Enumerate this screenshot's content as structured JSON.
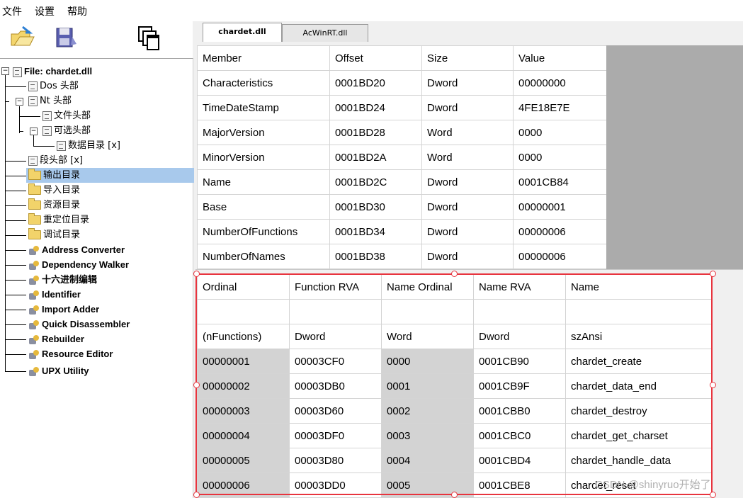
{
  "menu": {
    "file": "文件",
    "settings": "设置",
    "help": "帮助"
  },
  "toolbar": {
    "open_icon": "open-folder-icon",
    "save_icon": "save-disk-icon",
    "windows_icon": "cascade-windows-icon"
  },
  "tree": {
    "root": "File: chardet.dll",
    "dos": "Dos 头部",
    "nt": "Nt 头部",
    "file_header": "文件头部",
    "optional_header": "可选头部",
    "data_dir": "数据目录 [x]",
    "section": "段头部 [x]",
    "export": "输出目录",
    "import": "导入目录",
    "resource": "资源目录",
    "reloc": "重定位目录",
    "debug": "调试目录",
    "tools": [
      "Address Converter",
      "Dependency Walker",
      "十六进制编辑",
      "Identifier",
      "Import Adder",
      "Quick Disassembler",
      "Rebuilder",
      "Resource Editor",
      "UPX Utility"
    ]
  },
  "tabs": [
    "chardet.dll",
    "AcWinRT.dll"
  ],
  "top_table": {
    "headers": [
      "Member",
      "Offset",
      "Size",
      "Value"
    ],
    "rows": [
      [
        "Characteristics",
        "0001BD20",
        "Dword",
        "00000000"
      ],
      [
        "TimeDateStamp",
        "0001BD24",
        "Dword",
        "4FE18E7E"
      ],
      [
        "MajorVersion",
        "0001BD28",
        "Word",
        "0000"
      ],
      [
        "MinorVersion",
        "0001BD2A",
        "Word",
        "0000"
      ],
      [
        "Name",
        "0001BD2C",
        "Dword",
        "0001CB84"
      ],
      [
        "Base",
        "0001BD30",
        "Dword",
        "00000001"
      ],
      [
        "NumberOfFunctions",
        "0001BD34",
        "Dword",
        "00000006"
      ],
      [
        "NumberOfNames",
        "0001BD38",
        "Dword",
        "00000006"
      ]
    ]
  },
  "bottom_table": {
    "headers": [
      "Ordinal",
      "Function RVA",
      "Name Ordinal",
      "Name RVA",
      "Name"
    ],
    "types": [
      "(nFunctions)",
      "Dword",
      "Word",
      "Dword",
      "szAnsi"
    ],
    "rows": [
      [
        "00000001",
        "00003CF0",
        "0000",
        "0001CB90",
        "chardet_create"
      ],
      [
        "00000002",
        "00003DB0",
        "0001",
        "0001CB9F",
        "chardet_data_end"
      ],
      [
        "00000003",
        "00003D60",
        "0002",
        "0001CBB0",
        "chardet_destroy"
      ],
      [
        "00000004",
        "00003DF0",
        "0003",
        "0001CBC0",
        "chardet_get_charset"
      ],
      [
        "00000005",
        "00003D80",
        "0004",
        "0001CBD4",
        "chardet_handle_data"
      ],
      [
        "00000006",
        "00003DD0",
        "0005",
        "0001CBE8",
        "chardet_reset"
      ]
    ]
  },
  "watermark": "CSDN @shinyruo开始了"
}
